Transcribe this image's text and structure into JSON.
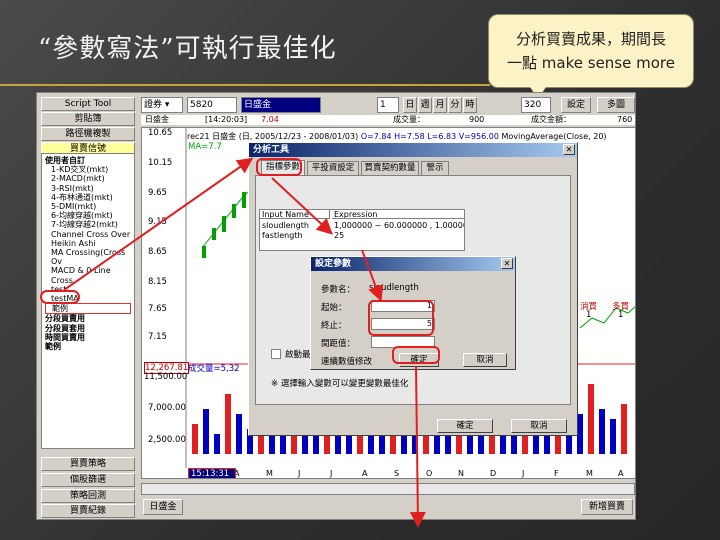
{
  "slide": {
    "title": "“參數寫法”可執行最佳化",
    "callout_line1": "分析買賣成果，期間長",
    "callout_line2": "一點 make sense more"
  },
  "sidebar": {
    "top_buttons": [
      "Script Tool",
      "剪貼簿",
      "路徑機複製",
      "買賣信號"
    ],
    "tree": [
      {
        "t": "使用者自訂",
        "g": true
      },
      {
        "t": "1-KD交叉(mkt)"
      },
      {
        "t": "2-MACD(mkt)"
      },
      {
        "t": "3-RSI(mkt)"
      },
      {
        "t": "4-布林通道(mkt)"
      },
      {
        "t": "5-DMI(mkt)"
      },
      {
        "t": "6-均線穿越(mkt)"
      },
      {
        "t": "7-均線穿越2(mkt)"
      },
      {
        "t": "Channel Cross Over"
      },
      {
        "t": "Heikin Ashi"
      },
      {
        "t": "MA Crossing(Cross Ov"
      },
      {
        "t": "MACD & 0 Line Cross"
      },
      {
        "t": "test"
      },
      {
        "t": "testMA"
      },
      {
        "t": "範例",
        "hl": true
      },
      {
        "t": "分段買賣用",
        "g": true
      },
      {
        "t": "分段買套用",
        "g": true
      },
      {
        "t": "時間買賣用",
        "g": true
      },
      {
        "t": "範例",
        "g": true
      }
    ],
    "bottom_buttons": [
      "買賣策略",
      "個股篩選",
      "策略回測",
      "買賣紀錄"
    ]
  },
  "toolbar": {
    "market": "證券",
    "code": "5820",
    "name": "日盛金",
    "period_num": "1",
    "period_units": [
      "日",
      "週",
      "月",
      "分",
      "時"
    ],
    "count": "320",
    "btn_a": "設定",
    "btn_b": "多圖"
  },
  "quote": {
    "name": "日盛金",
    "time": "[14:20:03]",
    "price": "7.04",
    "vol_label": "成交量：",
    "vol": "900",
    "amt_label": "成交金額：",
    "amt": "760"
  },
  "chart": {
    "info_head": "rec21",
    "info_name": "日盛金",
    "info_range": "(日, 2005/12/23 - 2008/01/03)",
    "info_ohlc": "O=7.84 H=7.58 L=6.83 V=956.00",
    "info_ma": "MovingAverage(Close, 20)",
    "ma_label": "MA=7.7",
    "price_ticks": [
      "10.65",
      "10.15",
      "9.65",
      "9.15",
      "8.65",
      "8.15",
      "7.65",
      "7.15"
    ],
    "vol_label": "成交量=5,32",
    "vol_ticks": [
      "12,267.81",
      "11,500.00",
      "7,000.00",
      "2,500.00"
    ],
    "date_box": "15:13:31",
    "month_ticks": [
      "M",
      "A",
      "M",
      "J",
      "J",
      "A",
      "S",
      "O",
      "N",
      "D",
      "J",
      "F",
      "M",
      "A"
    ],
    "buy_label": "消買",
    "buy_val": "1",
    "buy_label2": "多買",
    "buy_val2": "1"
  },
  "analysis_dialog": {
    "title": "分析工具",
    "close": "✕",
    "tabs": [
      "指標參數",
      "平投資設定",
      "買賣契約數量",
      "警示"
    ],
    "col1": "Input Name",
    "col2": "Expression",
    "rows": [
      {
        "name": "sloudlength",
        "expr": "1,000000 ~ 60.000000 , 1.000000"
      },
      {
        "name": "fastlength",
        "expr": "25"
      }
    ],
    "checkbox_label": "啟動最適化",
    "note": "※ 選擇輸入變數可以變更變數最佳化",
    "ok": "確定",
    "cancel": "取消"
  },
  "sub_dialog": {
    "title": "設定參數",
    "close": "✕",
    "param_label": "參數名：",
    "param_value": "sloudlength",
    "start_label": "起始：",
    "start_value": "1",
    "end_label": "終止：",
    "end_value": "5",
    "step_label": "間距值：",
    "step_value": "",
    "mode_label": "連續數值修改",
    "ok": "確定",
    "cancel": "取消"
  },
  "bottom": {
    "tab": "日盛金",
    "right_btn": "新增買賣"
  },
  "colors": {
    "accent": "#e02020",
    "callout_bg": "#fbf3c5",
    "title_rule": "#c8a23a"
  }
}
